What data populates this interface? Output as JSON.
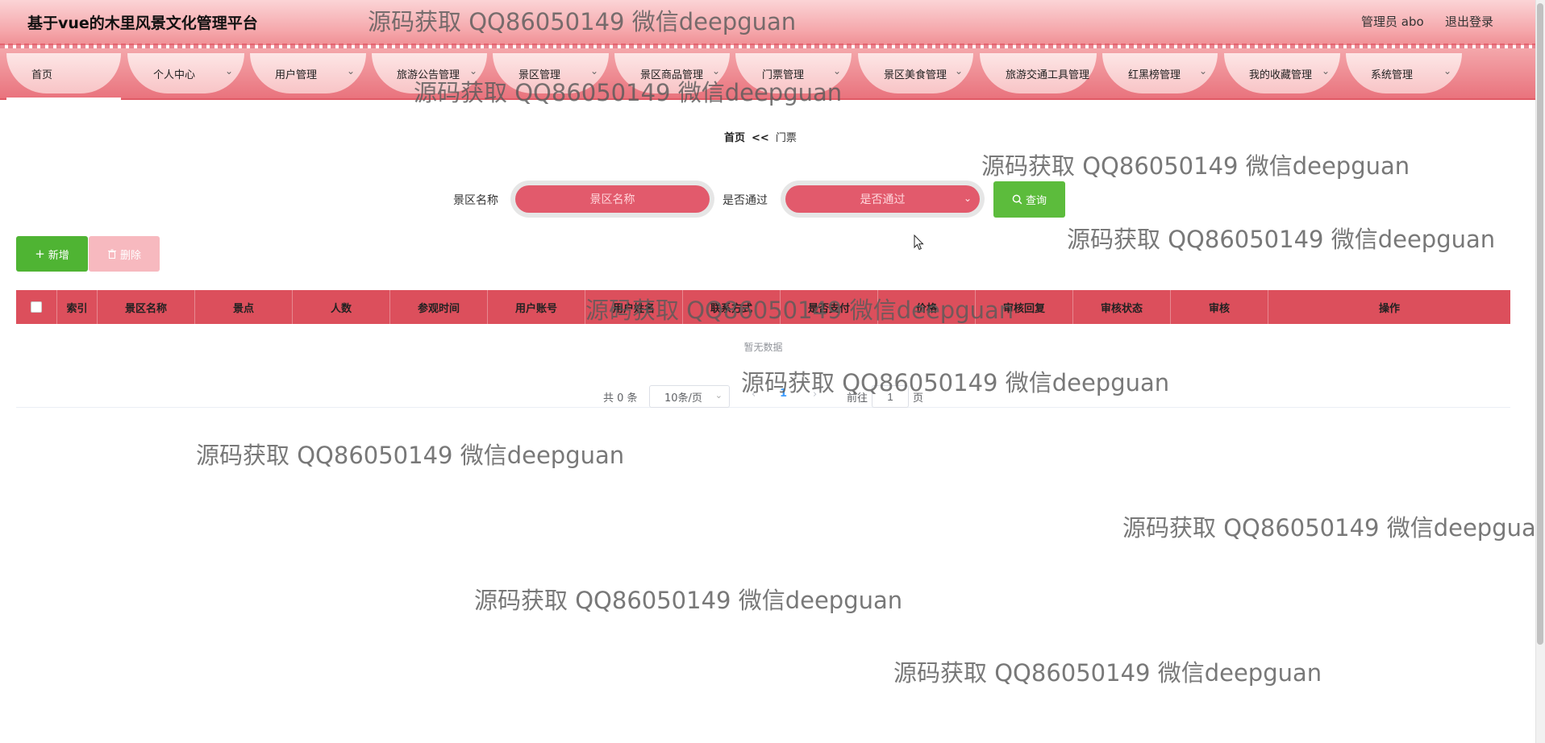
{
  "header": {
    "title": "基于vue的木里风景文化管理平台",
    "admin": "管理员 abo",
    "logout": "退出登录"
  },
  "nav": {
    "items": [
      {
        "label": "首页",
        "has_dropdown": false
      },
      {
        "label": "个人中心",
        "has_dropdown": true
      },
      {
        "label": "用户管理",
        "has_dropdown": true
      },
      {
        "label": "旅游公告管理",
        "has_dropdown": true
      },
      {
        "label": "景区管理",
        "has_dropdown": true
      },
      {
        "label": "景区商品管理",
        "has_dropdown": true
      },
      {
        "label": "门票管理",
        "has_dropdown": true
      },
      {
        "label": "景区美食管理",
        "has_dropdown": true
      },
      {
        "label": "旅游交通工具管理",
        "has_dropdown": false
      },
      {
        "label": "红黑榜管理",
        "has_dropdown": true
      },
      {
        "label": "我的收藏管理",
        "has_dropdown": true
      },
      {
        "label": "系统管理",
        "has_dropdown": true
      }
    ]
  },
  "breadcrumb": {
    "home": "首页",
    "separator": "<<",
    "current": "门票"
  },
  "search": {
    "name_label": "景区名称",
    "name_placeholder": "景区名称",
    "pass_label": "是否通过",
    "pass_placeholder": "是否通过",
    "query_button": "查询"
  },
  "actions": {
    "add": "新增",
    "delete": "删除"
  },
  "table": {
    "columns": [
      "索引",
      "景区名称",
      "景点",
      "人数",
      "参观时间",
      "用户账号",
      "用户姓名",
      "联系方式",
      "是否支付",
      "价格",
      "审核回复",
      "审核状态",
      "审核",
      "操作"
    ],
    "empty_text": "暂无数据"
  },
  "pagination": {
    "total": "共 0 条",
    "page_size": "10条/页",
    "current_page": "1",
    "goto_prefix": "前往",
    "goto_value": "1",
    "goto_suffix": "页"
  },
  "watermark": "源码获取 QQ86050149 微信deepguan",
  "colors": {
    "nav_bg": "#e9737d",
    "table_header": "#dc4f5c",
    "search_button": "#5cbc3c",
    "add_button": "#4fb433",
    "delete_button": "#f7b9bf",
    "input_fill": "#e25a6c"
  }
}
